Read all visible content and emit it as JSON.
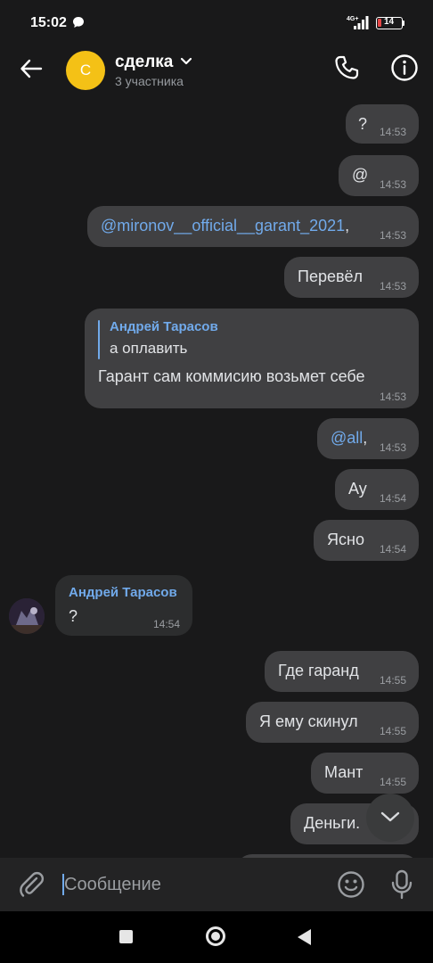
{
  "status_bar": {
    "time": "15:02",
    "battery": "14",
    "network": "4G+"
  },
  "header": {
    "avatar_letter": "С",
    "title": "сделка",
    "subtitle": "3 участника"
  },
  "messages": [
    {
      "text": "?",
      "time": "14:53"
    },
    {
      "text": "@",
      "time": "14:53"
    },
    {
      "mention": "@mironov__official__garant_2021",
      "suffix": ",",
      "time": "14:53"
    },
    {
      "text": "Перевёл",
      "time": "14:53"
    },
    {
      "reply_author": "Андрей Тарасов",
      "reply_text": "а оплавить",
      "text": "Гарант сам коммисию возьмет себе",
      "time": "14:53"
    },
    {
      "mention": "@all",
      "suffix": ",",
      "time": "14:53"
    },
    {
      "text": "Ау",
      "time": "14:54"
    },
    {
      "text": "Ясно",
      "time": "14:54"
    },
    {
      "sender": "Андрей Тарасов",
      "text": "?",
      "time": "14:54",
      "incoming": true
    },
    {
      "text": "Где гаранд",
      "time": "14:55"
    },
    {
      "text": "Я ему скинул",
      "time": "14:55"
    },
    {
      "text": "Мант",
      "time": "14:55"
    },
    {
      "text": "Деньги.",
      "time": ""
    }
  ],
  "composer": {
    "placeholder": "Сообщение"
  },
  "colors": {
    "background": "#19191a",
    "outgoing_bubble": "#404042",
    "incoming_bubble": "#2c2d2e",
    "accent": "#71aaeb",
    "avatar": "#f4c116"
  },
  "icons": [
    "chat-icon",
    "back-icon",
    "chevron-down-icon",
    "call-icon",
    "info-icon",
    "attach-icon",
    "emoji-icon",
    "mic-icon",
    "chevron-down-icon"
  ]
}
